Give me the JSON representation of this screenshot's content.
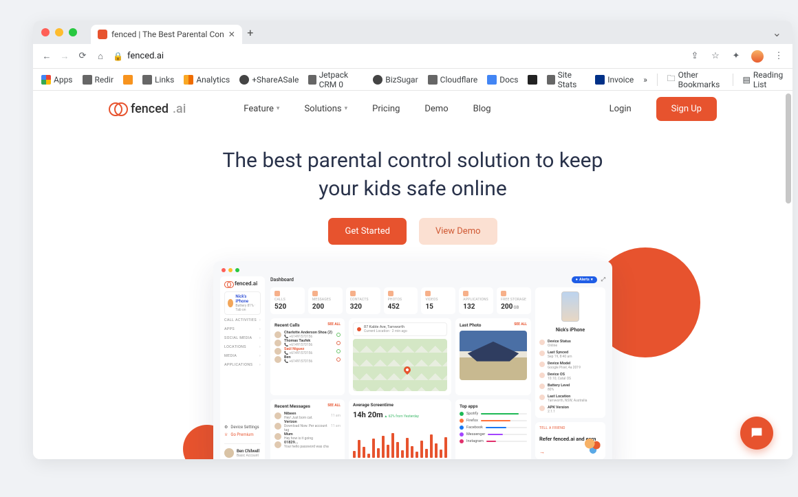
{
  "browser": {
    "tab_title": "fenced | The Best Parental Con",
    "url": "fenced.ai",
    "bookmarks": [
      {
        "label": "Apps"
      },
      {
        "label": "Redir"
      },
      {
        "label": "Links"
      },
      {
        "label": "Analytics"
      },
      {
        "label": "+ShareASale"
      },
      {
        "label": "Jetpack CRM 0"
      },
      {
        "label": "BizSugar"
      },
      {
        "label": "Cloudflare"
      },
      {
        "label": "Docs"
      },
      {
        "label": "Site Stats"
      },
      {
        "label": "Invoice"
      }
    ],
    "bookmarks_overflow": "»",
    "other_bookmarks": "Other Bookmarks",
    "reading_list": "Reading List"
  },
  "site": {
    "brand_text": "fenced",
    "brand_suffix": ".ai",
    "nav": {
      "feature": "Feature",
      "solutions": "Solutions",
      "pricing": "Pricing",
      "demo": "Demo",
      "blog": "Blog",
      "login": "Login",
      "signup": "Sign Up"
    },
    "hero": {
      "title": "The best parental control solution to keep your kids safe online",
      "cta_primary": "Get Started",
      "cta_secondary": "View Demo"
    }
  },
  "shot": {
    "sidebar": {
      "brand": "fenced.ai",
      "device_name": "Nick's iPhone",
      "device_sub": "Battery 81% · Tab on",
      "items": [
        "CALL ACTIVITIES",
        "APPS",
        "SOCIAL MEDIA",
        "LOCATIONS",
        "MEDIA",
        "APPLICATIONS"
      ],
      "settings": "Device Settings",
      "premium": "Go Premium",
      "account_name": "Ben Chilwell",
      "account_role": "Basic Account"
    },
    "dashboard_label": "Dashboard",
    "alerts_pill": "Alerts",
    "stats": [
      {
        "label": "CALLS",
        "value": "520"
      },
      {
        "label": "MESSAGES",
        "value": "200"
      },
      {
        "label": "CONTACTS",
        "value": "320"
      },
      {
        "label": "PHOTOS",
        "value": "452"
      },
      {
        "label": "VIDEOS",
        "value": "15"
      },
      {
        "label": "APPLICATIONS",
        "value": "132"
      },
      {
        "label": "FREE STORAGE",
        "value": "200",
        "unit": "GB"
      }
    ],
    "recent_calls": {
      "title": "Recent Calls",
      "see_all": "SEE ALL",
      "rows": [
        {
          "name": "Charlotte Anderson Shoa (2)",
          "phone": "+61491570156"
        },
        {
          "name": "Thomas Taufek",
          "phone": "+61491570156"
        },
        {
          "name": "Saúl Niguez",
          "phone": "+61491570156",
          "alert": true
        },
        {
          "name": "Ben",
          "phone": "+61491570156"
        }
      ]
    },
    "location": {
      "address": "87 Kable Ave, Tamworth",
      "sub": "Current Location · 2 min ago"
    },
    "last_photo": {
      "title": "Last Photo",
      "see_all": "SEE ALL"
    },
    "screentime": {
      "title": "Average Screentime",
      "value": "14h 20m",
      "delta": "62% from Yesterday",
      "bars": [
        20,
        55,
        34,
        12,
        58,
        30,
        66,
        40,
        74,
        48,
        22,
        60,
        36,
        18,
        52,
        28,
        70,
        44,
        26,
        62
      ]
    },
    "recent_messages": {
      "title": "Recent Messages",
      "see_all": "SEE ALL",
      "rows": [
        {
          "name": "Nibeen",
          "text": "Hey! Just born cat.",
          "time": "11 am"
        },
        {
          "name": "Verizon",
          "text": "Download Now. Per account tag",
          "time": "11 am"
        },
        {
          "name": "Mum",
          "text": "Hey how is it going"
        },
        {
          "name": "01829...",
          "text": "Your hello password was cha"
        }
      ]
    },
    "top_apps": {
      "title": "Top apps",
      "rows": [
        {
          "name": "Spotify",
          "pct": 82,
          "color": "#1db954"
        },
        {
          "name": "Firefox",
          "pct": 64,
          "color": "#ff7139"
        },
        {
          "name": "Facebook",
          "pct": 50,
          "color": "#1877f2"
        },
        {
          "name": "Messenger",
          "pct": 38,
          "color": "#a344ff"
        },
        {
          "name": "Instagram",
          "pct": 24,
          "color": "#e1306c"
        }
      ]
    },
    "device": {
      "name": "Nick's iPhone",
      "rows": [
        {
          "k": "Device Status",
          "v": "Online"
        },
        {
          "k": "Last Synced",
          "v": "Sep 19, 8:40 am"
        },
        {
          "k": "Device Model",
          "v": "Google Pixel, 4a 2019"
        },
        {
          "k": "Device OS",
          "v": "10.10, Catal OS"
        },
        {
          "k": "Battery Level",
          "v": "80%"
        },
        {
          "k": "Last Location",
          "v": "Tamworth, NSW, Australia"
        },
        {
          "k": "APK Version",
          "v": "2.1.1"
        }
      ]
    },
    "refer": {
      "tag": "TELL A FRIEND",
      "title": "Refer fenced.ai and earn"
    }
  }
}
